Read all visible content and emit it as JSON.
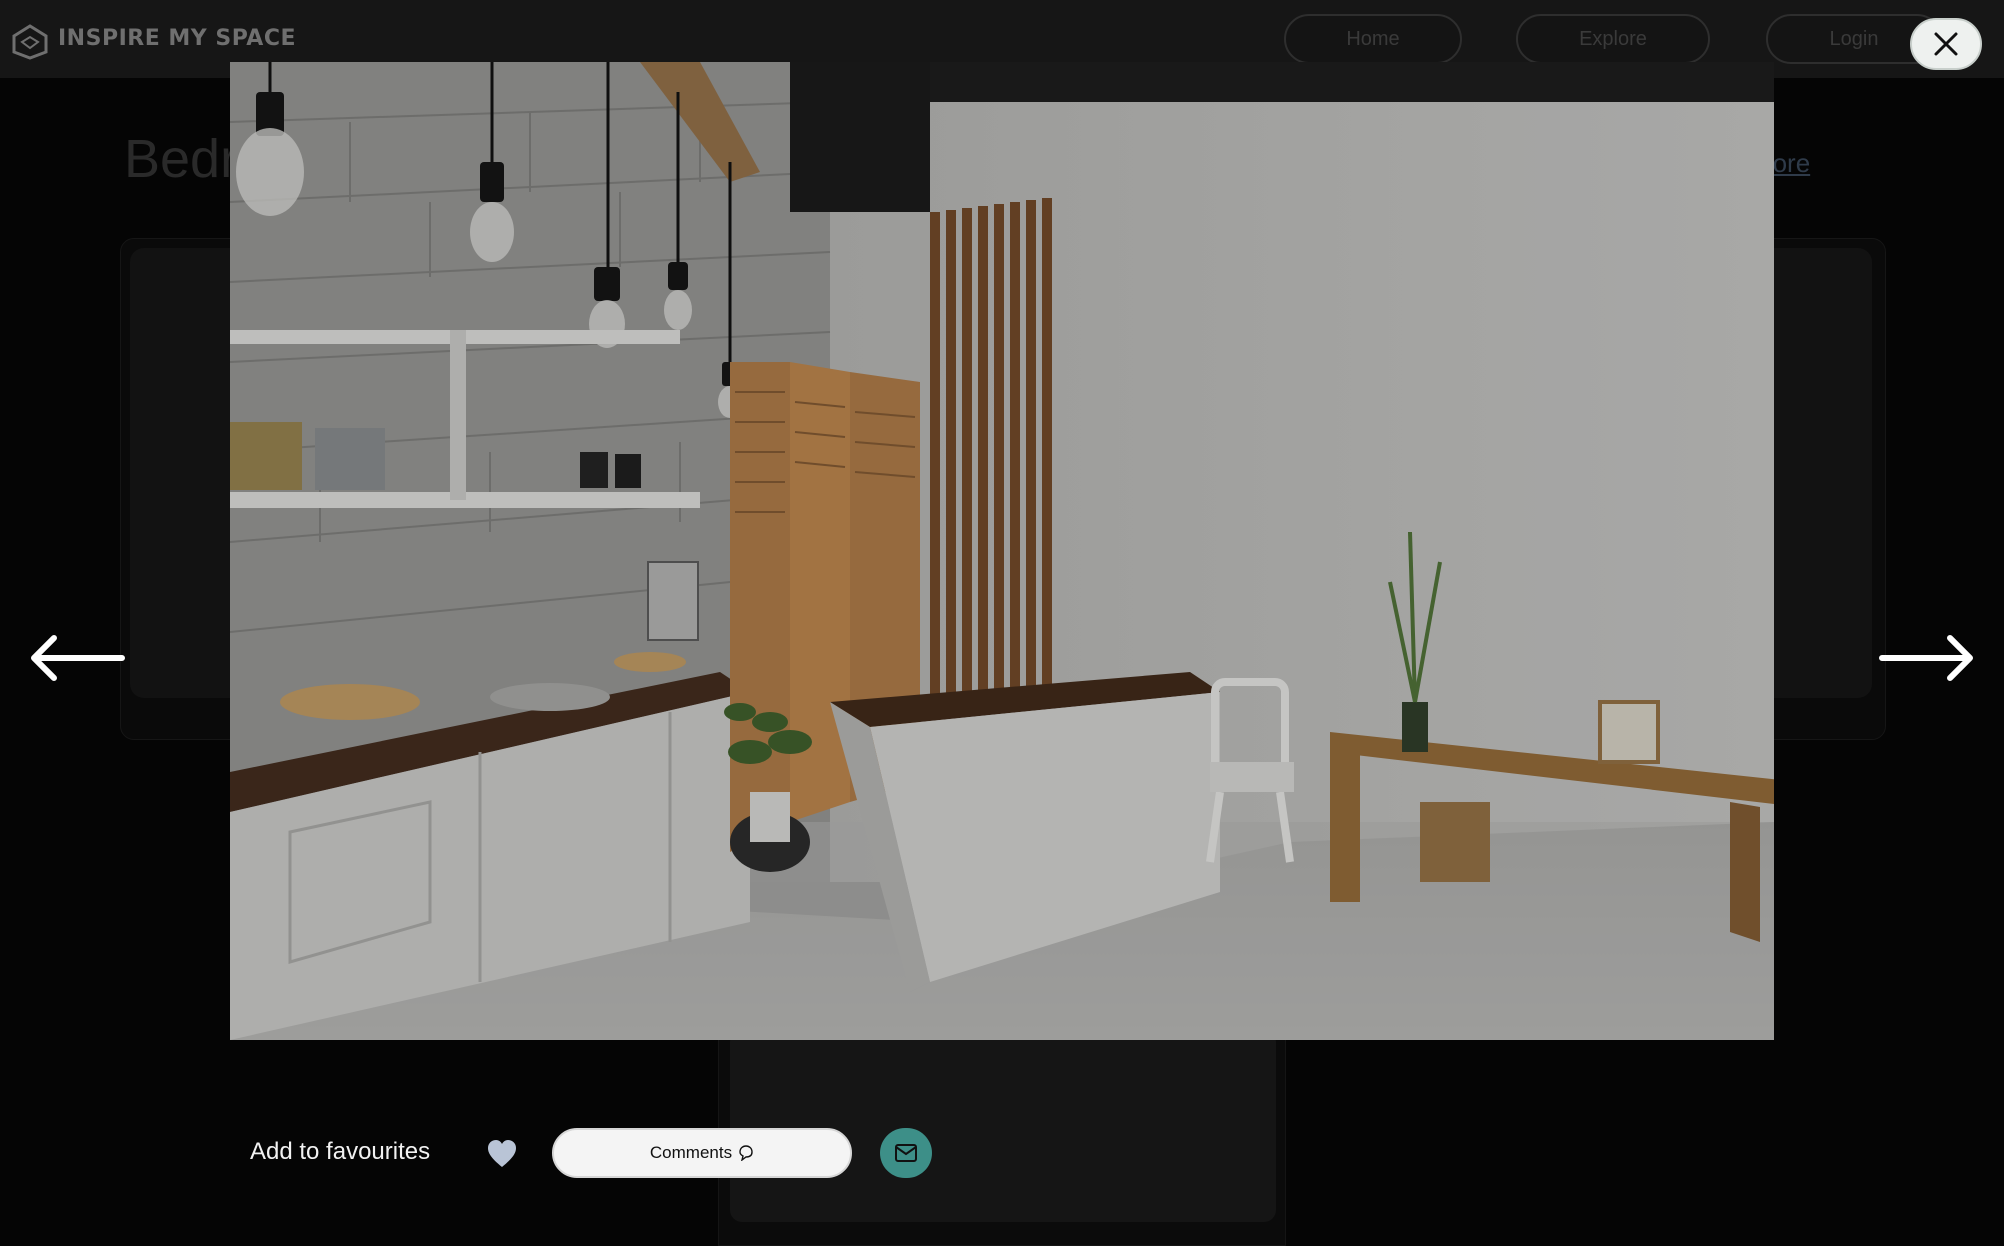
{
  "app": {
    "brand": "INSPIRE MY SPACE",
    "nav": [
      {
        "label": "Home"
      },
      {
        "label": "Explore"
      },
      {
        "label": "Login"
      }
    ]
  },
  "page": {
    "heading": "Bedr",
    "back_link": "Explore"
  },
  "modal": {
    "add_to_favourites": "Add to favourites",
    "comments_label": "Comments",
    "icons": {
      "close": "close-icon",
      "prev": "arrow-left-icon",
      "next": "arrow-right-icon",
      "favourite": "heart-icon",
      "comments": "chat-bubble-icon",
      "share": "mail-icon"
    },
    "colors": {
      "share_button": "#3d8f88",
      "heart": "#b9c4d6"
    }
  }
}
